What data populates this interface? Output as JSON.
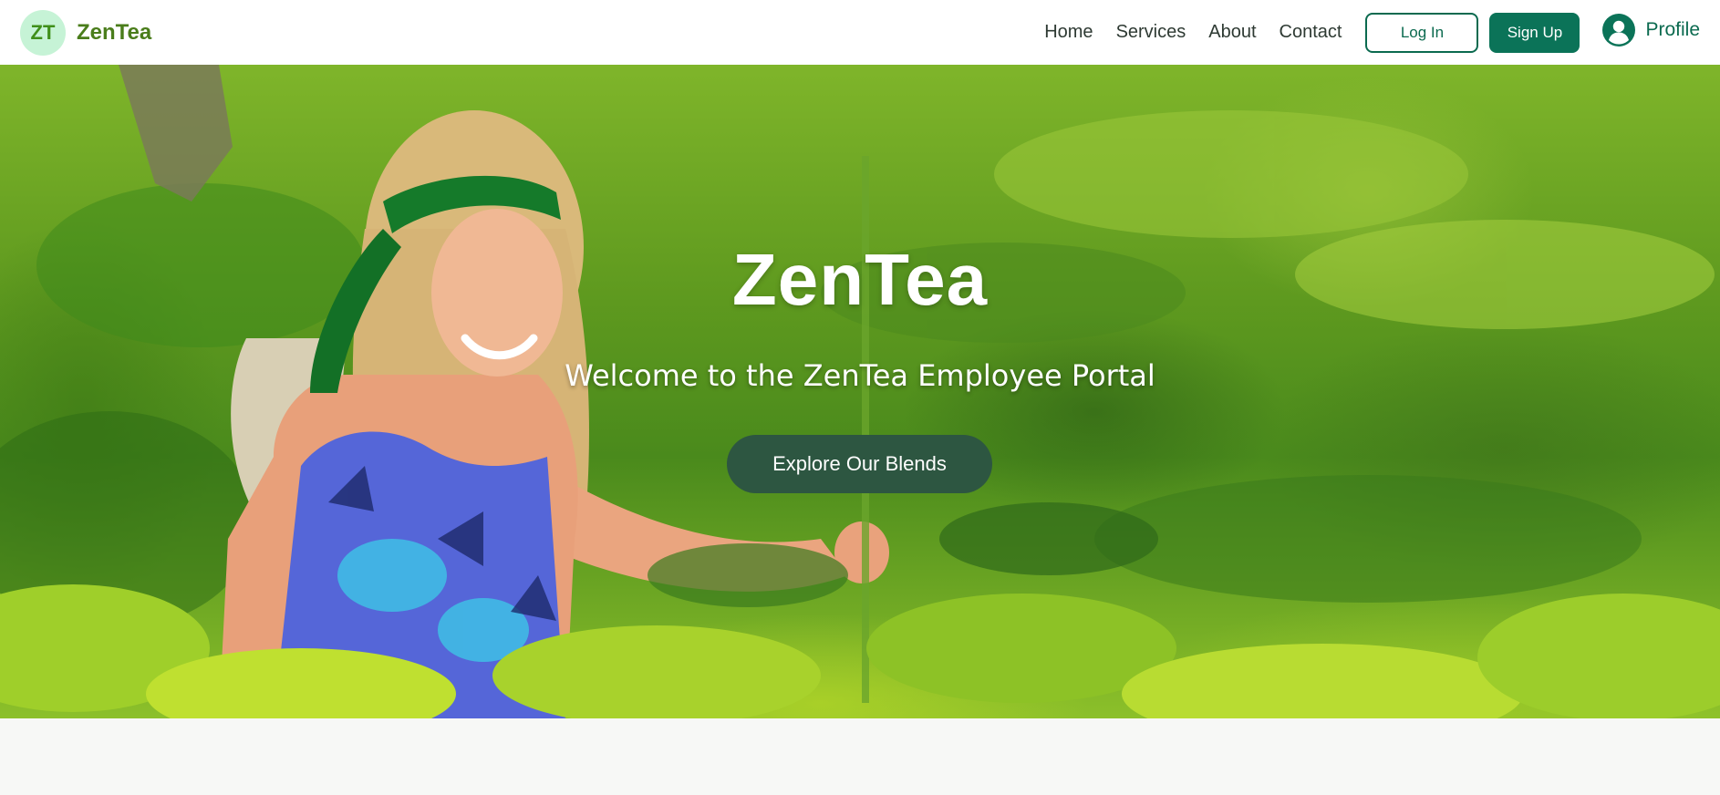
{
  "header": {
    "logo_initials": "ZT",
    "brand_name": "ZenTea",
    "nav": [
      {
        "label": "Home"
      },
      {
        "label": "Services"
      },
      {
        "label": "About"
      },
      {
        "label": "Contact"
      }
    ],
    "login_label": "Log In",
    "signup_label": "Sign Up",
    "profile_label": "Profile",
    "profile_icon": "user-circle-icon"
  },
  "hero": {
    "title": "ZenTea",
    "subtitle": "Welcome to the ZenTea Employee Portal",
    "cta_label": "Explore Our Blends",
    "background": "photo-woman-in-tea-plantation"
  },
  "colors": {
    "brand_green": "#0b7358",
    "logo_text": "#4a7d1b",
    "logo_badge_bg": "#c6f3d6",
    "cta_bg": "#2d5641",
    "page_bg": "#f7f8f6"
  }
}
